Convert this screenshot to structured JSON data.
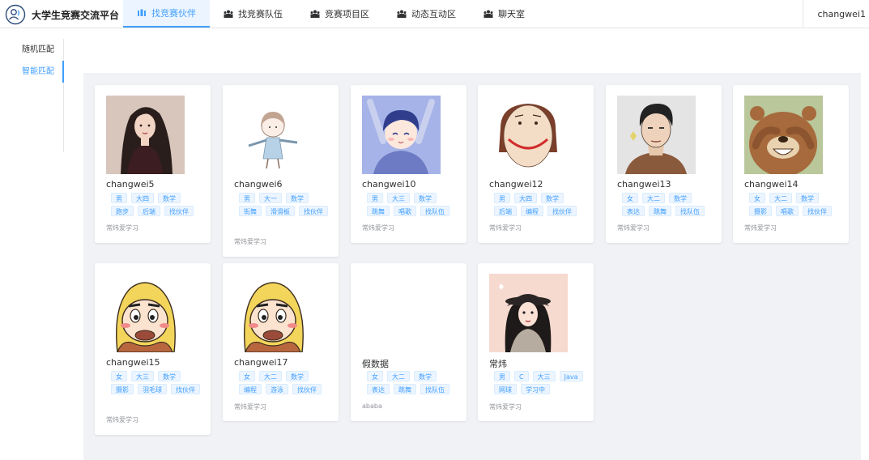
{
  "app": {
    "title": "大学生竞赛交流平台",
    "username": "changwei1"
  },
  "nav": [
    {
      "label": "找竞赛伙伴",
      "icon": "user-icon",
      "active": true
    },
    {
      "label": "找竞赛队伍",
      "icon": "team-icon",
      "active": false
    },
    {
      "label": "竞赛项目区",
      "icon": "team-icon",
      "active": false
    },
    {
      "label": "动态互动区",
      "icon": "team-icon",
      "active": false
    },
    {
      "label": "聊天室",
      "icon": "team-icon",
      "active": false
    }
  ],
  "sidebar": [
    {
      "label": "随机匹配",
      "active": false
    },
    {
      "label": "智能匹配",
      "active": true
    }
  ],
  "cards": [
    {
      "name": "changwei5",
      "tags": [
        "男",
        "大四",
        "数学",
        "跑步",
        "后端",
        "找伙伴"
      ],
      "signature": "常炜爱学习",
      "avatar": "girl-portrait",
      "avatar_bg": "#d8c6bc"
    },
    {
      "name": "changwei6",
      "tags": [
        "男",
        "大一",
        "数学",
        "街舞",
        "滑滑板",
        "找伙伴"
      ],
      "signature": "常炜爱学习",
      "avatar": "chibi-sketch",
      "avatar_bg": "#ffffff"
    },
    {
      "name": "changwei10",
      "tags": [
        "男",
        "大三",
        "数学",
        "跳舞",
        "唱歌",
        "找队伍"
      ],
      "signature": "常炜爱学习",
      "avatar": "anime-boy",
      "avatar_bg": "#a6b3e8"
    },
    {
      "name": "changwei12",
      "tags": [
        "男",
        "大四",
        "数学",
        "后端",
        "编程",
        "找伙伴"
      ],
      "signature": "常炜爱学习",
      "avatar": "smile-face",
      "avatar_bg": "#ffffff"
    },
    {
      "name": "changwei13",
      "tags": [
        "女",
        "大二",
        "数学",
        "表达",
        "跳舞",
        "找队伍"
      ],
      "signature": "常炜爱学习",
      "avatar": "man-sketch",
      "avatar_bg": "#e4e4e4"
    },
    {
      "name": "changwei14",
      "tags": [
        "女",
        "大二",
        "数学",
        "摄影",
        "唱歌",
        "找伙伴"
      ],
      "signature": "常炜爱学习",
      "avatar": "brown-bear",
      "avatar_bg": "#b9c79b"
    },
    {
      "name": "changwei15",
      "tags": [
        "女",
        "大三",
        "数学",
        "摄影",
        "羽毛球",
        "找伙伴"
      ],
      "signature": "常炜爱学习",
      "avatar": "shinchan",
      "avatar_bg": "#ffffff"
    },
    {
      "name": "changwei17",
      "tags": [
        "女",
        "大二",
        "数学",
        "编程",
        "游泳",
        "找伙伴"
      ],
      "signature": "常炜爱学习",
      "avatar": "shinchan",
      "avatar_bg": "#ffffff"
    },
    {
      "name": "假数据",
      "tags": [
        "女",
        "大二",
        "数学",
        "表达",
        "跳舞",
        "找队伍"
      ],
      "signature": "ababa",
      "avatar": "blank",
      "avatar_bg": "#ffffff"
    },
    {
      "name": "常炜",
      "tags": [
        "男",
        "C",
        "大三",
        "Java",
        "网球",
        "学习中"
      ],
      "signature": "常炜爱学习",
      "avatar": "girl-hat",
      "avatar_bg": "#f6d9cf"
    }
  ]
}
